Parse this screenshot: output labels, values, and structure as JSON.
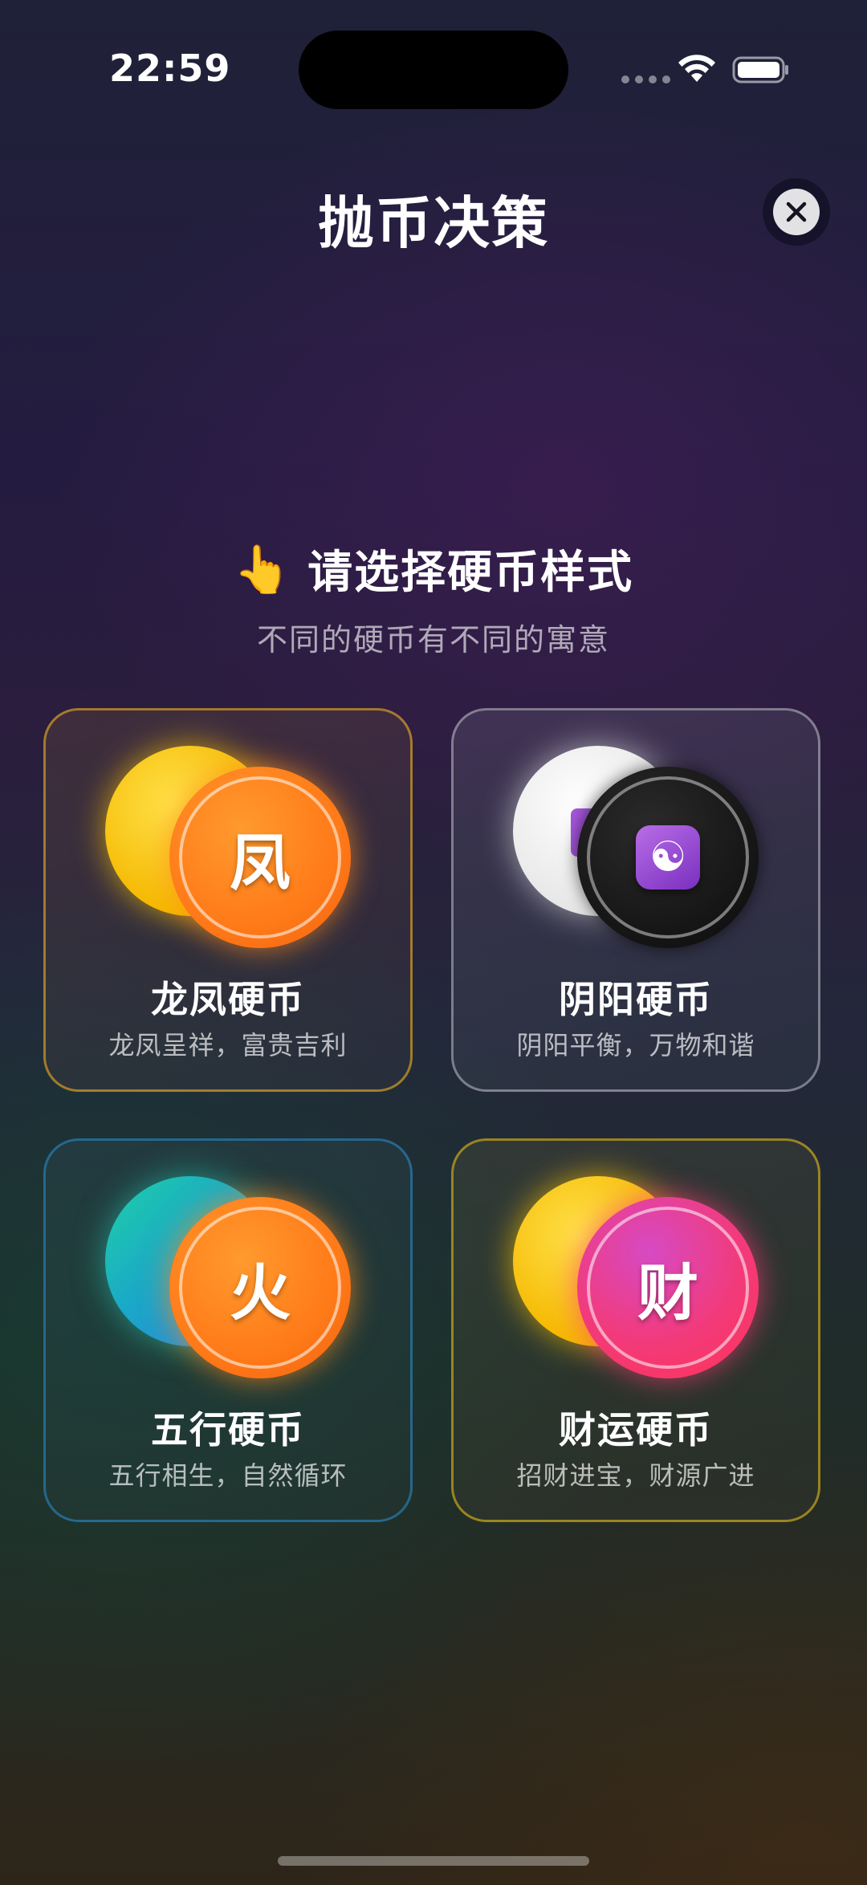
{
  "status_bar": {
    "time": "22:59",
    "icons": [
      "cellular-dots",
      "wifi",
      "battery"
    ]
  },
  "header": {
    "title": "抛币决策",
    "close_icon": "close-icon"
  },
  "prompt": {
    "icon": "pointing-hand-icon",
    "title": "请选择硬币样式",
    "subtitle": "不同的硬币有不同的寓意"
  },
  "coin_styles": [
    {
      "name": "龙凤硬币",
      "description": "龙凤呈祥，富贵吉利",
      "front_char": "凤",
      "colors": {
        "back": "#f5b800",
        "front": "#ff7a18",
        "border": "#c89628"
      }
    },
    {
      "name": "阴阳硬币",
      "description": "阴阳平衡，万物和谐",
      "front_icon": "yin-yang-icon",
      "colors": {
        "back": "#e6e6e6",
        "front": "#141414",
        "border": "#bebec8"
      }
    },
    {
      "name": "五行硬币",
      "description": "五行相生，自然循环",
      "front_char": "火",
      "colors": {
        "back": "#1aa8c8",
        "front": "#ff7a18",
        "border": "#2878aa"
      }
    },
    {
      "name": "财运硬币",
      "description": "招财进宝，财源广进",
      "front_char": "财",
      "colors": {
        "back": "#f5b800",
        "front": "#f23a7a",
        "border": "#bea01e"
      }
    }
  ]
}
